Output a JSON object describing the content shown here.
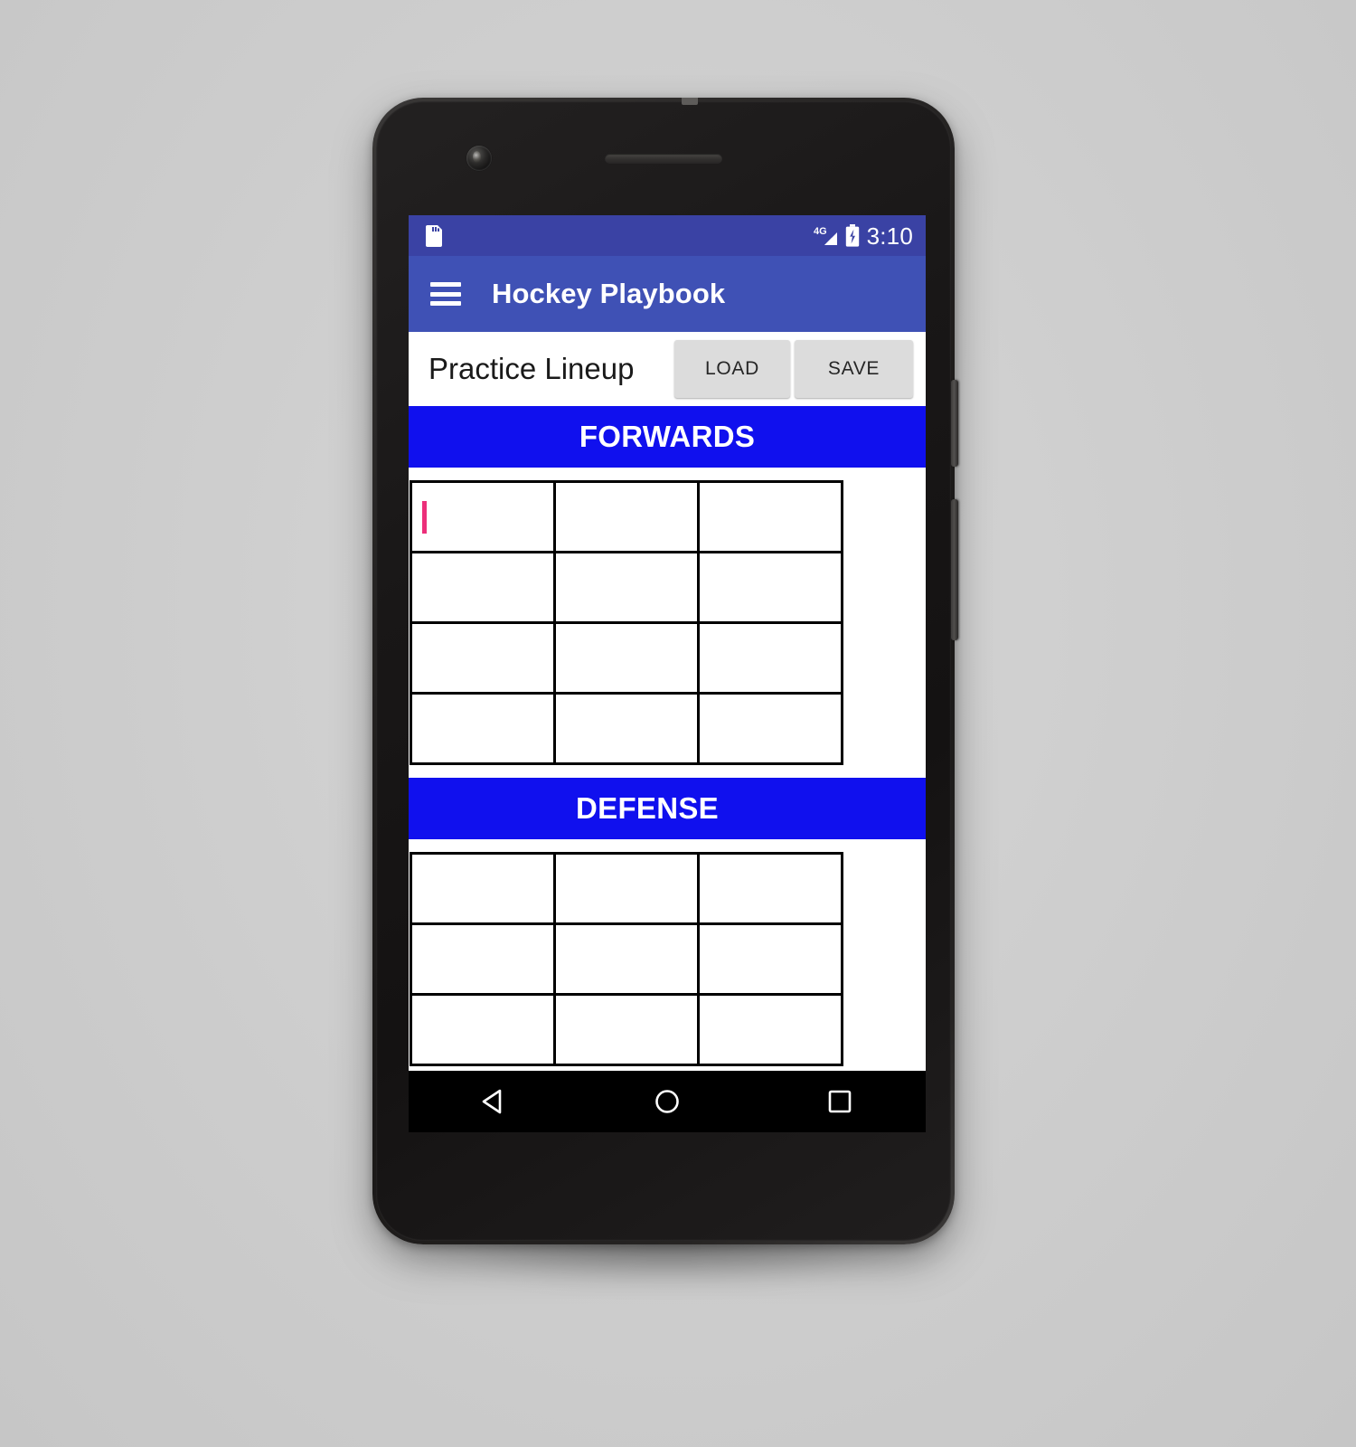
{
  "status_bar": {
    "sdcard_icon": "sdcard-icon",
    "network_label": "4G",
    "signal_icon": "signal-bars-icon",
    "battery_icon": "battery-charging-icon",
    "time": "3:10"
  },
  "app_bar": {
    "menu_icon": "hamburger-menu-icon",
    "title": "Hockey Playbook"
  },
  "toolbar": {
    "lineup_name_value": "Practice Lineup",
    "lineup_name_placeholder": "Lineup name",
    "load_label": "LOAD",
    "save_label": "SAVE"
  },
  "sections": [
    {
      "title": "FORWARDS",
      "rows": [
        [
          "",
          "",
          ""
        ],
        [
          "",
          "",
          ""
        ],
        [
          "",
          "",
          ""
        ],
        [
          "",
          "",
          ""
        ]
      ]
    },
    {
      "title": "DEFENSE",
      "rows": [
        [
          "",
          "",
          ""
        ],
        [
          "",
          "",
          ""
        ],
        [
          "",
          "",
          ""
        ]
      ]
    }
  ],
  "nav_bar": {
    "back_icon": "back-triangle-icon",
    "home_icon": "home-circle-icon",
    "recents_icon": "recents-square-icon"
  },
  "colors": {
    "status_bar": "#3a42a4",
    "app_bar": "#3f51b5",
    "section_header": "#1010ee",
    "caret": "#ec2f7a",
    "button_face": "#dcdcdc",
    "nav_bar": "#000000"
  }
}
